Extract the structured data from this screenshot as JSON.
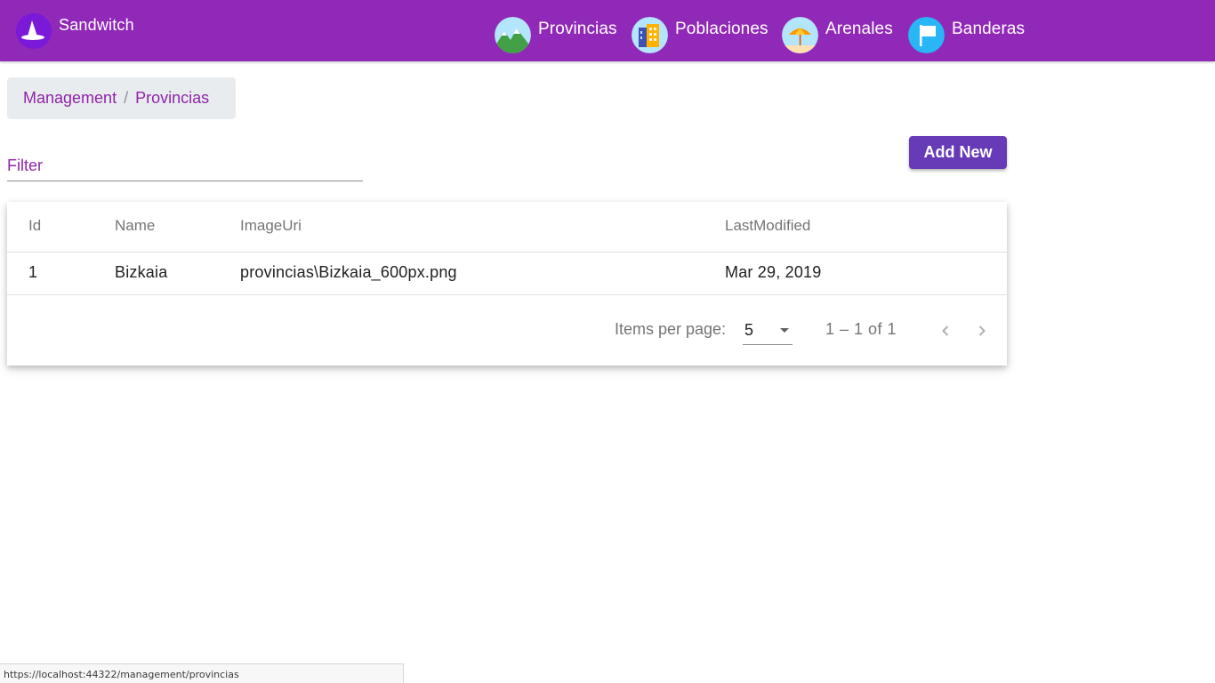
{
  "app": {
    "brand_name": "Sandwitch",
    "brand_color": "#9129b8",
    "accent_color": "#673ab7",
    "link_color": "#8e24aa"
  },
  "nav": {
    "items": [
      {
        "label": "Provincias",
        "icon": "mountains-icon"
      },
      {
        "label": "Poblaciones",
        "icon": "buildings-icon"
      },
      {
        "label": "Arenales",
        "icon": "beach-umbrella-icon"
      },
      {
        "label": "Banderas",
        "icon": "flag-icon"
      }
    ]
  },
  "breadcrumb": {
    "items": [
      "Management",
      "Provincias"
    ],
    "separator": "/"
  },
  "filter": {
    "placeholder": "Filter",
    "value": ""
  },
  "toolbar": {
    "add_label": "Add New"
  },
  "table": {
    "columns": [
      "Id",
      "Name",
      "ImageUri",
      "LastModified"
    ],
    "rows": [
      [
        "1",
        "Bizkaia",
        "provincias\\Bizkaia_600px.png",
        "Mar 29, 2019"
      ]
    ]
  },
  "paginator": {
    "items_per_page_label": "Items per page:",
    "page_size": "5",
    "range_label": "1 – 1 of 1"
  },
  "status_bar": {
    "url": "https://localhost:44322/management/provincias"
  }
}
